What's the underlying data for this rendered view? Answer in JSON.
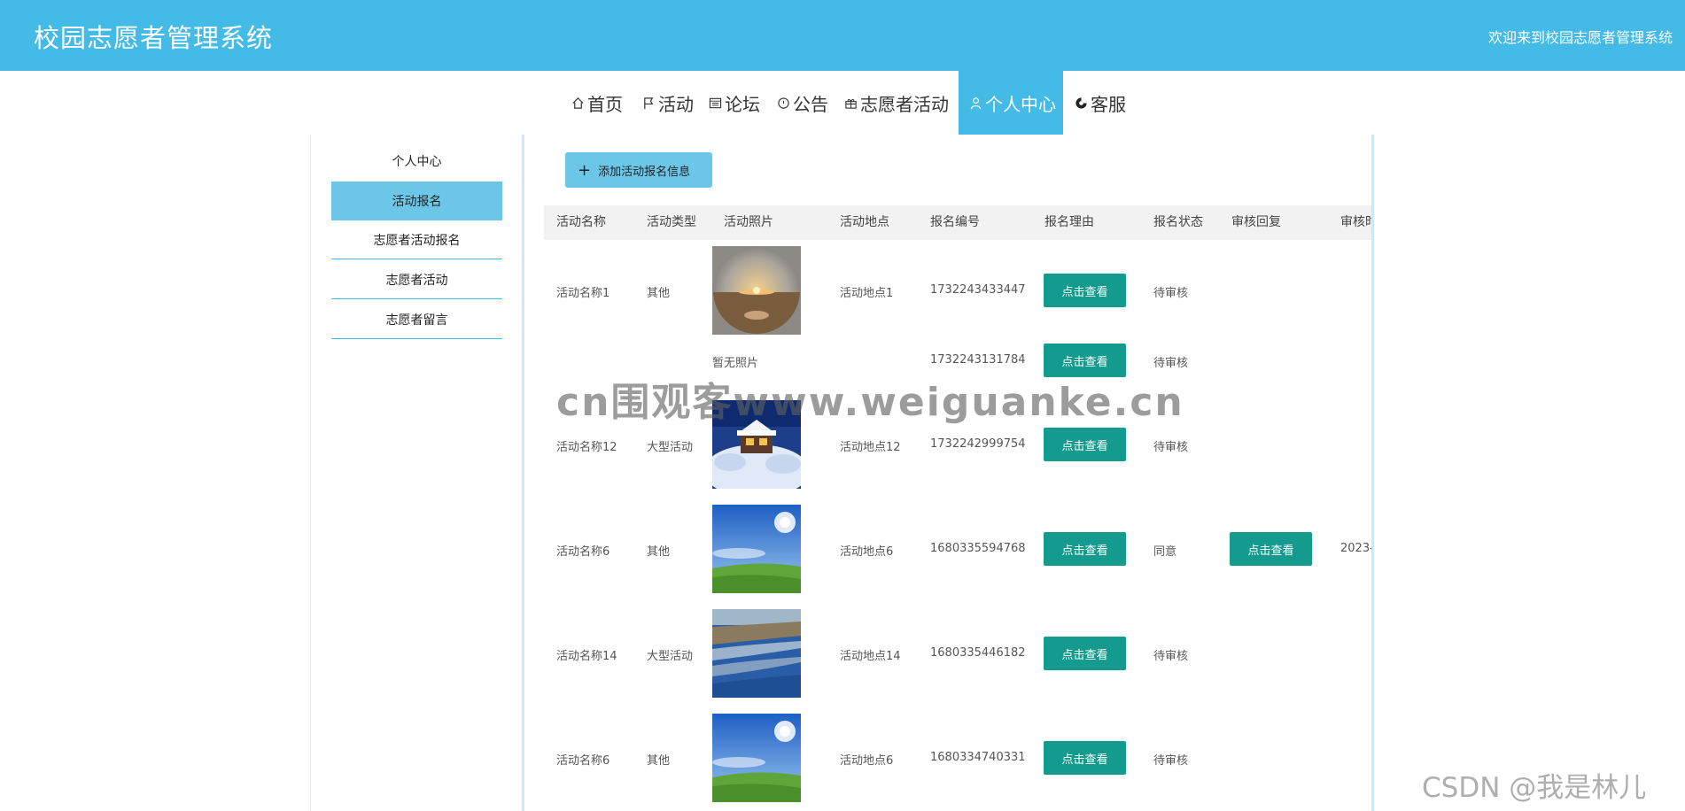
{
  "header": {
    "title": "校园志愿者管理系统",
    "welcome": "欢迎来到校园志愿者管理系统",
    "bg_color": "#44bbe6"
  },
  "nav": {
    "items": [
      {
        "label": "首页",
        "icon": "home-icon"
      },
      {
        "label": "活动",
        "icon": "flag-icon"
      },
      {
        "label": "论坛",
        "icon": "forum-icon"
      },
      {
        "label": "公告",
        "icon": "notice-icon"
      },
      {
        "label": "志愿者活动",
        "icon": "gift-icon"
      },
      {
        "label": "个人中心",
        "icon": "user-icon",
        "active": true
      },
      {
        "label": "客服",
        "icon": "service-icon"
      }
    ]
  },
  "sidebar": {
    "items": [
      {
        "label": "个人中心"
      },
      {
        "label": "活动报名",
        "active": true
      },
      {
        "label": "志愿者活动报名"
      },
      {
        "label": "志愿者活动"
      },
      {
        "label": "志愿者留言"
      }
    ]
  },
  "toolbar": {
    "add_label": "添加活动报名信息"
  },
  "table": {
    "columns": [
      "活动名称",
      "活动类型",
      "活动照片",
      "活动地点",
      "报名编号",
      "报名理由",
      "报名状态",
      "审核回复",
      "审核时"
    ],
    "view_label": "点击查看",
    "no_photo": "暂无照片",
    "rows": [
      {
        "name": "活动名称1",
        "type": "其他",
        "photo": "desert-sunset",
        "location": "活动地点1",
        "number": "1732243433447",
        "status": "待审核",
        "reply": false,
        "time": ""
      },
      {
        "name": "",
        "type": "",
        "photo": "none",
        "location": "",
        "number": "1732243131784",
        "status": "待审核",
        "reply": false,
        "time": ""
      },
      {
        "name": "活动名称12",
        "type": "大型活动",
        "photo": "snow-house",
        "location": "活动地点12",
        "number": "1732242999754",
        "status": "待审核",
        "reply": false,
        "time": ""
      },
      {
        "name": "活动名称6",
        "type": "其他",
        "photo": "grass-sky",
        "location": "活动地点6",
        "number": "1680335594768",
        "status": "同意",
        "reply": true,
        "time": "2023-0"
      },
      {
        "name": "活动名称14",
        "type": "大型活动",
        "photo": "coast",
        "location": "活动地点14",
        "number": "1680335446182",
        "status": "待审核",
        "reply": false,
        "time": ""
      },
      {
        "name": "活动名称6",
        "type": "其他",
        "photo": "grass-sky",
        "location": "活动地点6",
        "number": "1680334740331",
        "status": "待审核",
        "reply": false,
        "time": ""
      }
    ]
  },
  "watermark": "cn围观客www.weiguanke.cn",
  "credit": "CSDN @我是林儿",
  "colors": {
    "accent": "#44bbe6",
    "button": "#159a8e",
    "sidebar_active": "#6cc6e8"
  }
}
